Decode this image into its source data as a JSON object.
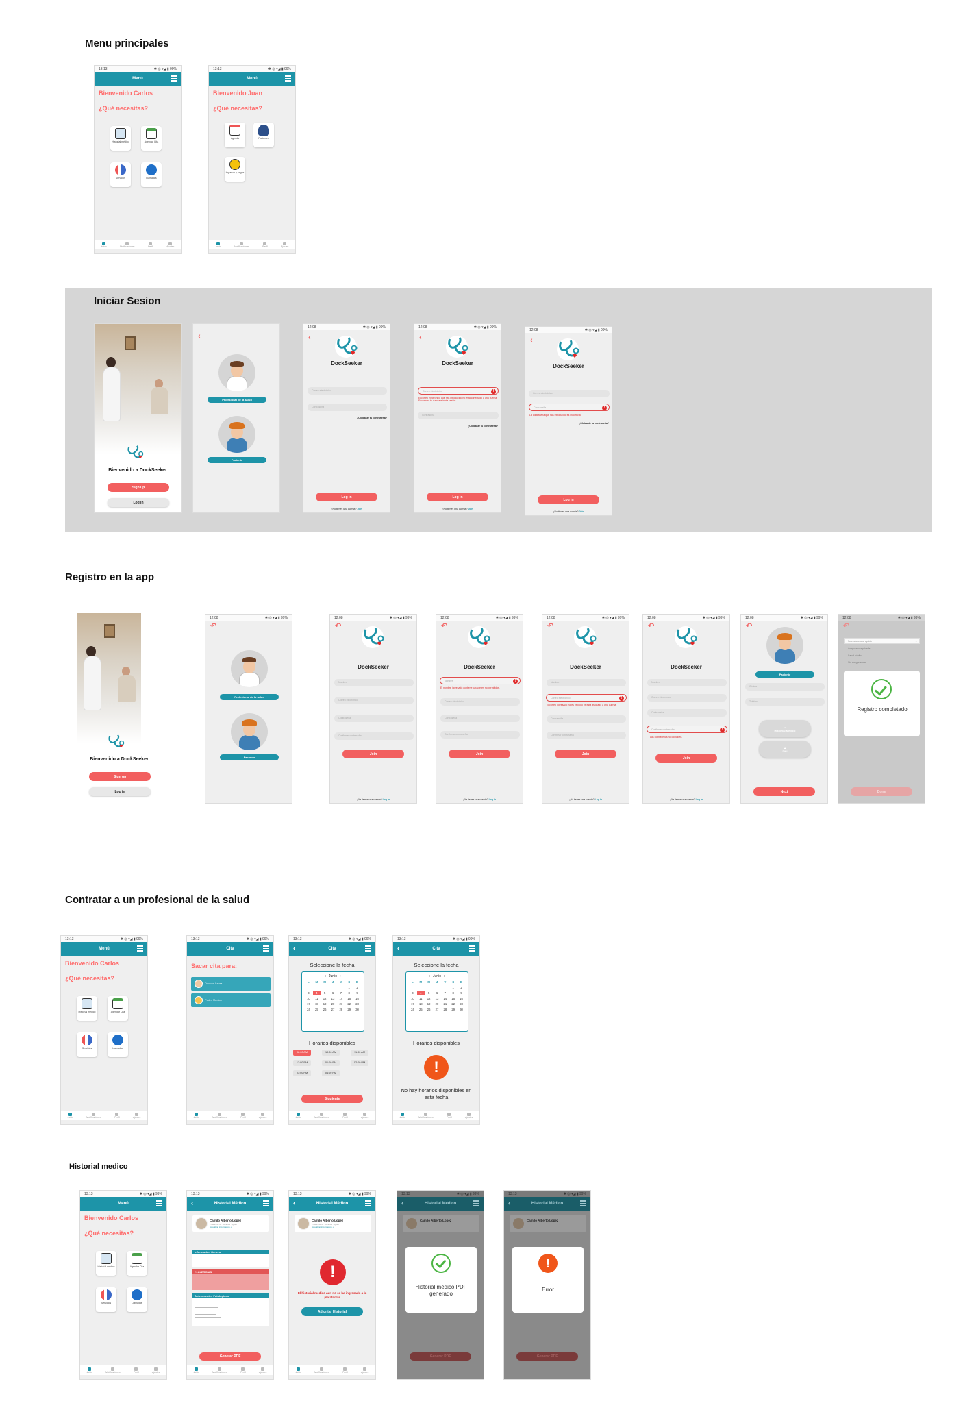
{
  "sections": {
    "menu": "Menu principales",
    "login": "Iniciar Sesion",
    "register": "Registro en la app",
    "hire": "Contratar a un profesional de la salud",
    "history": "Historial medico"
  },
  "status": {
    "time_a": "13:13",
    "time_b": "12:08",
    "icons": "✱ ◎ ▾◢ ▮ 99%"
  },
  "appbar": {
    "menu": "Menú",
    "cita": "Cita",
    "historial": "Historial Médico"
  },
  "menu_carlos": {
    "greeting": "Bienvenido Carlos",
    "question": "¿Qué necesitas?",
    "tiles": [
      "Historial médico",
      "Agendar Cita",
      "Servicios",
      "Llamadas"
    ]
  },
  "menu_juan": {
    "greeting": "Bienvenido Juan",
    "question": "¿Qué necesitas?",
    "tiles": [
      "Agenda",
      "Pacientes",
      "Ingresos y pagos"
    ]
  },
  "navbar": [
    "Inicio",
    "Notificaciones",
    "Perfil",
    "Ajustes"
  ],
  "login": {
    "welcome": "Bienvenido a DockSeeker",
    "signup": "Sign up",
    "login": "Log in",
    "role_pro": "Profesional de la salud",
    "role_patient": "Paciente",
    "brand": "DockSeeker",
    "email_ph": "Correo electrónico",
    "password_ph": "Contraseña",
    "forgot": "¿Olvidaste tu contraseña?",
    "err_email": "El correo electrónico que has introducido no está conectado a una cuenta. Encuentra tu cuenta e inicia sesión.",
    "err_password": "La contraseña que has introducido es incorrecta.",
    "no_account": "¿No tienes una cuenta?",
    "join_link": "Join"
  },
  "register": {
    "name_ph": "Nombre",
    "email_ph": "Correo electrónico",
    "password_ph": "Contraseña",
    "confirm_ph": "Confirmar contraseña",
    "join": "Join",
    "err_name": "El nombre ingresado contiene caracteres no permitidos.",
    "err_email": "El correo ingresado no es válido o ya está asociado a una cuenta.",
    "err_confirm": "Las contraseñas no coinciden.",
    "have_account": "¿Ya tienes una cuenta?",
    "login_link": "Log in",
    "patient": "Paciente",
    "id_ph": "Cédula",
    "phone_ph": "Teléfono",
    "upload1": "Historial Médico",
    "upload2": "DNI",
    "next": "Next",
    "dropdown": "Seleccione una opción",
    "options": [
      "Aseguradora privada",
      "Salud pública",
      "Sin aseguradora"
    ],
    "done": "Done",
    "success": "Registro completado"
  },
  "hire": {
    "book_label": "Sacar cita para:",
    "doctors": [
      "Doctora Laura",
      "Pedro Médico"
    ],
    "select_date": "Seleccione la fecha",
    "month": "Junio",
    "weekdays": [
      "L",
      "M",
      "M",
      "J",
      "V",
      "S",
      "D"
    ],
    "days_cal1": [
      "",
      "",
      "",
      "",
      "",
      "1",
      "2",
      "3",
      "4",
      "5",
      "6",
      "7",
      "8",
      "9",
      "10",
      "11",
      "12",
      "13",
      "14",
      "15",
      "16",
      "17",
      "18",
      "19",
      "20",
      "21",
      "22",
      "23",
      "24",
      "25",
      "26",
      "27",
      "28",
      "29",
      "30",
      "",
      "",
      "",
      "",
      "",
      "",
      ""
    ],
    "sel_day_1": "4",
    "sel_day_2": "4",
    "available": "Horarios disponibles",
    "slots": [
      "08:00 AM",
      "10:00 AM",
      "11:00 AM",
      "12:00 PM",
      "01:00 PM",
      "02:00 PM",
      "03:00 PM",
      "04:00 PM"
    ],
    "next": "Siguiente",
    "no_hours": "No hay horarios disponibles en esta fecha"
  },
  "history": {
    "patient_name": "Camilo Alberto Lopez",
    "patient_sub": "1712345678 · 28 años · Quito",
    "patient_link": "Actualizar información ✓",
    "general_info": "Información General",
    "alert": "⚠ ALERGIAS",
    "antecedents": "Antecedentes Patológicos",
    "generate": "Generar PDF",
    "not_uploaded": "El historial medico aun no se ha ingresado a la plataforma",
    "attach": "Adjuntar Historial",
    "pdf_ok": "Historial médico PDF generado",
    "error": "Error"
  },
  "colors": {
    "teal": "#1d94a8",
    "coral": "#f25f5f",
    "band": "#d6d6d6"
  }
}
